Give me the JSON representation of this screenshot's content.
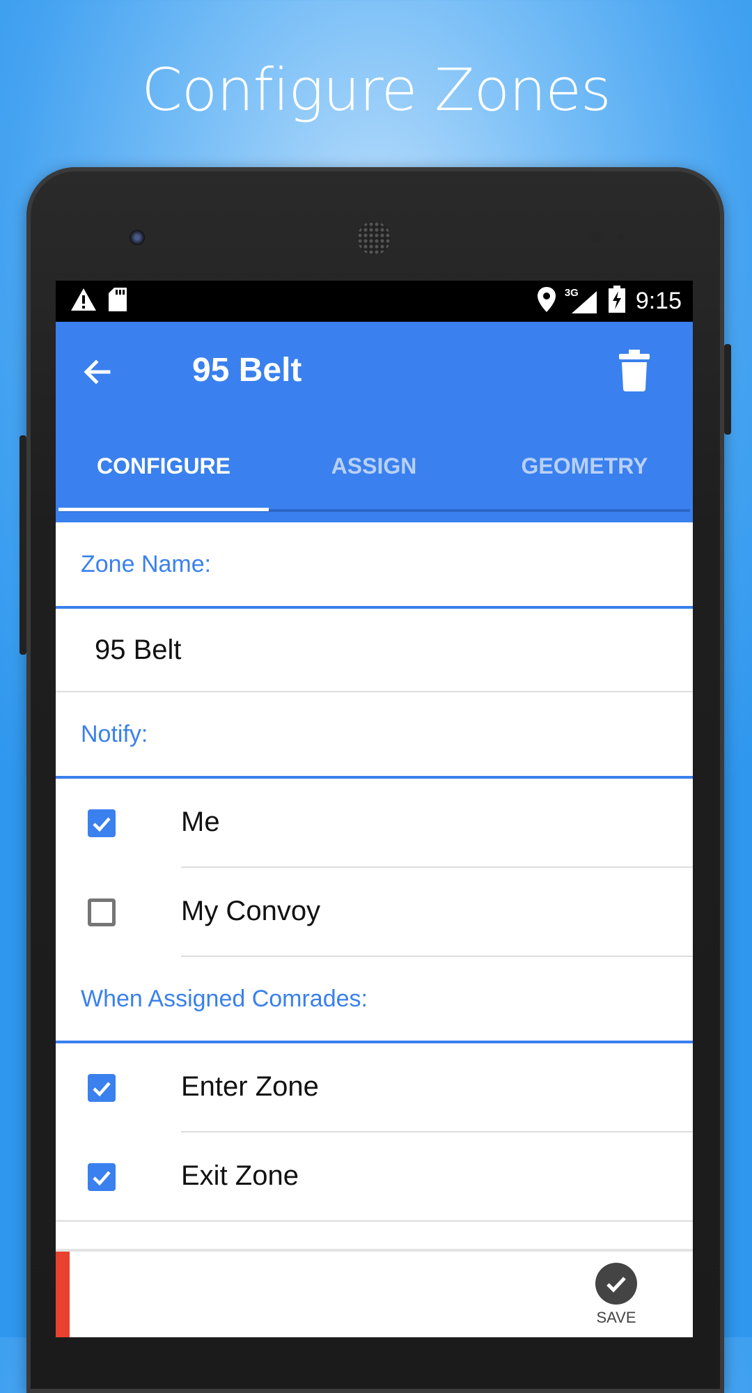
{
  "headline": "Configure Zones",
  "status_bar": {
    "time": "9:15",
    "network": "3G",
    "icons": [
      "warning-icon",
      "sd-card-icon",
      "location-pin-icon",
      "signal-icon",
      "battery-charging-icon"
    ]
  },
  "app_bar": {
    "title": "95 Belt",
    "back_icon": "arrow-back-icon",
    "action_icon": "trash-icon",
    "color": "#3a80ee"
  },
  "tabs": [
    {
      "label": "CONFIGURE",
      "active": true
    },
    {
      "label": "ASSIGN",
      "active": false
    },
    {
      "label": "GEOMETRY",
      "active": false
    }
  ],
  "form": {
    "zone_name_label": "Zone Name:",
    "zone_name_value": "95 Belt",
    "notify_label": "Notify:",
    "notify_options": [
      {
        "label": "Me",
        "checked": true
      },
      {
        "label": "My Convoy",
        "checked": false
      }
    ],
    "assigned_label": "When Assigned Comrades:",
    "assigned_options": [
      {
        "label": "Enter Zone",
        "checked": true
      },
      {
        "label": "Exit Zone",
        "checked": true
      }
    ]
  },
  "bottom_bar": {
    "save_label": "SAVE",
    "save_icon": "check-circle-icon"
  }
}
